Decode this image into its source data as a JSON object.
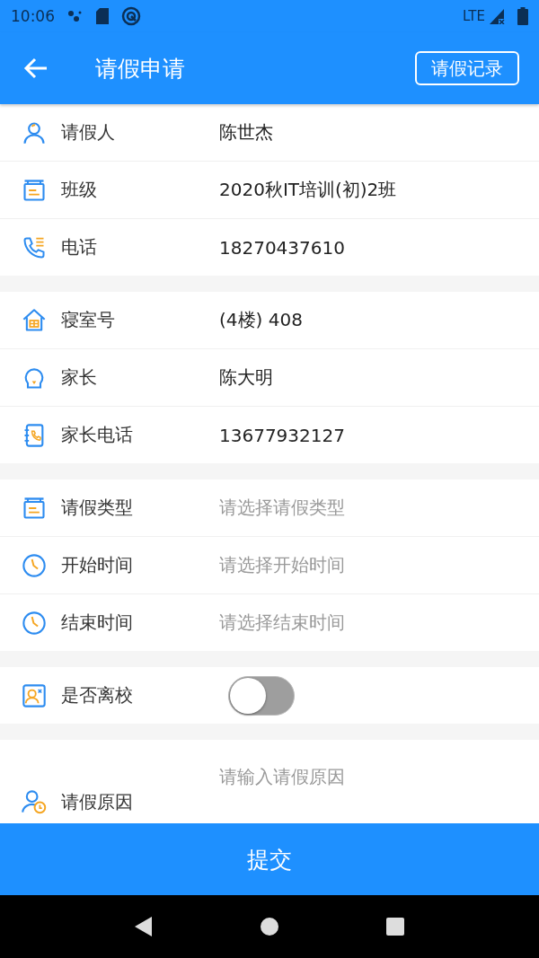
{
  "status_bar": {
    "time": "10:06",
    "network": "LTE"
  },
  "app_bar": {
    "title": "请假申请",
    "action": "请假记录"
  },
  "sections": [
    {
      "rows": [
        {
          "kind": "value",
          "label": "请假人",
          "value": "陈世杰"
        },
        {
          "kind": "value",
          "label": "班级",
          "value": "2020秋IT培训(初)2班"
        },
        {
          "kind": "value",
          "label": "电话",
          "value": "18270437610"
        }
      ]
    },
    {
      "rows": [
        {
          "kind": "value",
          "label": "寝室号",
          "value": "(4楼) 408"
        },
        {
          "kind": "value",
          "label": "家长",
          "value": "陈大明"
        },
        {
          "kind": "value",
          "label": "家长电话",
          "value": "13677932127"
        }
      ]
    },
    {
      "rows": [
        {
          "kind": "select",
          "label": "请假类型",
          "placeholder": "请选择请假类型"
        },
        {
          "kind": "select",
          "label": "开始时间",
          "placeholder": "请选择开始时间"
        },
        {
          "kind": "select",
          "label": "结束时间",
          "placeholder": "请选择结束时间"
        }
      ]
    },
    {
      "rows": [
        {
          "kind": "toggle",
          "label": "是否离校",
          "on": false
        }
      ]
    },
    {
      "rows": [
        {
          "kind": "textarea",
          "label": "请假原因",
          "placeholder": "请输入请假原因"
        }
      ]
    }
  ],
  "submit": "提交"
}
